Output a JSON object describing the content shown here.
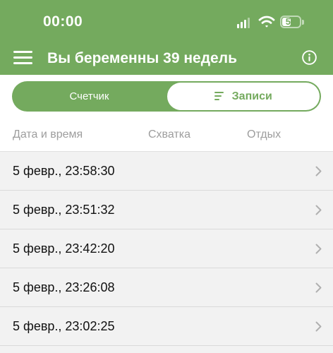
{
  "status_bar": {
    "time": "00:00",
    "battery": "51",
    "battery_level": 0.51
  },
  "header": {
    "title": "Вы беременны 39 недель",
    "menu_icon": "hamburger-menu-icon",
    "info_icon": "info-circle-icon"
  },
  "segmented_control": {
    "counter_label": "Счетчик",
    "records_label": "Записи",
    "records_icon": "list-lines-icon",
    "selected": "records"
  },
  "table": {
    "columns": [
      "Дата и время",
      "Схватка",
      "Отдых"
    ],
    "rows": [
      {
        "label": "5 февр., 23:58:30"
      },
      {
        "label": "5 февр., 23:51:32"
      },
      {
        "label": "5 февр., 23:42:20"
      },
      {
        "label": "5 февр., 23:26:08"
      },
      {
        "label": "5 февр., 23:02:25"
      }
    ]
  },
  "colors": {
    "accent": "#74aa5e",
    "background": "#f2f2f2",
    "muted_text": "#9d9d9d"
  }
}
